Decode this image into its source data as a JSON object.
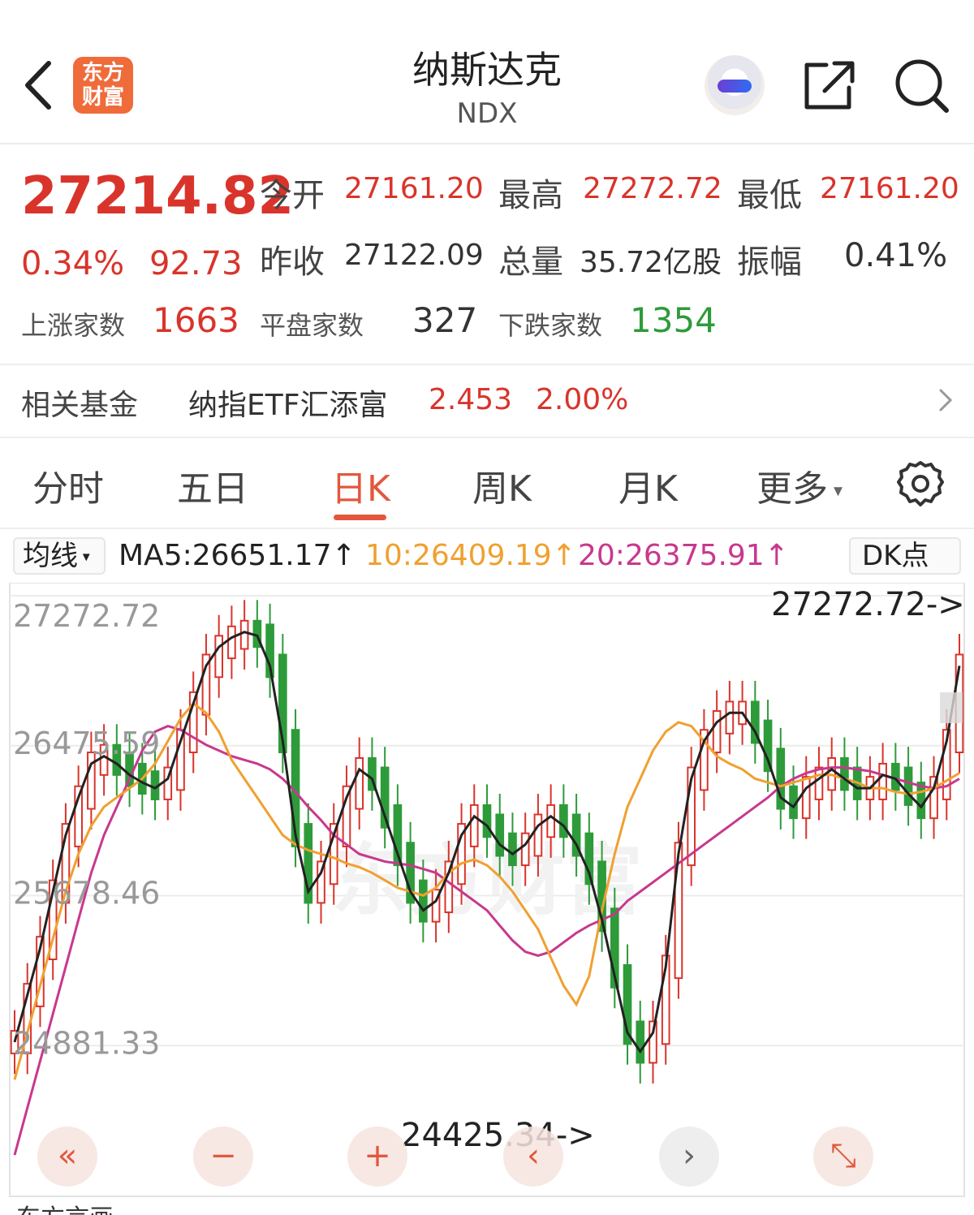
{
  "header": {
    "logo_line1": "东方",
    "logo_line2": "财富",
    "title": "纳斯达克",
    "subtitle": "NDX"
  },
  "quote": {
    "price": "27214.82",
    "change_pct": "0.34%",
    "change_amt": "92.73",
    "open_label": "今开",
    "open_value": "27161.20",
    "high_label": "最高",
    "high_value": "27272.72",
    "low_label": "最低",
    "low_value": "27161.20",
    "prev_close_label": "昨收",
    "prev_close_value": "27122.09",
    "volume_label": "总量",
    "volume_value": "35.72亿股",
    "amplitude_label": "振幅",
    "amplitude_value": "0.41%",
    "rise_label": "上涨家数",
    "rise_value": "1663",
    "flat_label": "平盘家数",
    "flat_value": "327",
    "fall_label": "下跌家数",
    "fall_value": "1354"
  },
  "fund": {
    "label": "相关基金",
    "name": "纳指ETF汇添富",
    "price": "2.453",
    "change": "2.00%"
  },
  "tabs": [
    "分时",
    "五日",
    "日K",
    "周K",
    "月K",
    "更多"
  ],
  "ma": {
    "selector": "均线",
    "ma5": "MA5:26651.17↑",
    "ma10": "10:26409.19↑",
    "ma20": "20:26375.91↑",
    "dk": "DK点"
  },
  "colors": {
    "up": "#d9342b",
    "down": "#2e9b3a",
    "accent": "#e2583e",
    "ma5": "#222222",
    "ma10": "#f0a030",
    "ma20": "#c8388e"
  },
  "icons": [
    "back-arrow-icon",
    "share-icon",
    "search-icon",
    "gear-icon",
    "dropdown-caret-icon",
    "chevron-right-icon"
  ],
  "chart_data": {
    "type": "candlestick",
    "y_tick_labels": [
      "27272.72",
      "26475.59",
      "25678.46",
      "24881.33"
    ],
    "ylim": [
      24425.34,
      27272.72
    ],
    "high_marker": "27272.72->",
    "low_marker": "24425.34->",
    "watermark": "东方财富",
    "ma5": [
      24900,
      25150,
      25400,
      25700,
      26000,
      26200,
      26380,
      26420,
      26380,
      26320,
      26280,
      26250,
      26300,
      26500,
      26700,
      26900,
      27000,
      27050,
      27080,
      27060,
      26900,
      26500,
      26000,
      25700,
      25800,
      26000,
      26200,
      26350,
      26300,
      26100,
      25900,
      25700,
      25600,
      25650,
      25800,
      26000,
      26100,
      26050,
      25950,
      25900,
      25950,
      26050,
      26100,
      26050,
      25950,
      25800,
      25550,
      25250,
      24950,
      24850,
      24950,
      25300,
      25900,
      26300,
      26500,
      26600,
      26650,
      26650,
      26550,
      26400,
      26200,
      26150,
      26250,
      26300,
      26350,
      26300,
      26250,
      26250,
      26320,
      26300,
      26220,
      26150,
      26250,
      26500,
      26900
    ],
    "ma10": [
      24700,
      24950,
      25200,
      25450,
      25700,
      25900,
      26050,
      26150,
      26200,
      26250,
      26300,
      26380,
      26500,
      26620,
      26700,
      26650,
      26550,
      26400,
      26300,
      26200,
      26100,
      26000,
      25950,
      25920,
      25900,
      25880,
      25850,
      25830,
      25800,
      25760,
      25720,
      25700,
      25680,
      25720,
      25800,
      25850,
      25870,
      25840,
      25780,
      25700,
      25600,
      25500,
      25350,
      25200,
      25100,
      25250,
      25600,
      25900,
      26150,
      26300,
      26450,
      26550,
      26600,
      26580,
      26500,
      26420,
      26380,
      26350,
      26300,
      26280,
      26260,
      26280,
      26300,
      26320,
      26320,
      26300,
      26280,
      26250,
      26250,
      26230,
      26220,
      26230,
      26250,
      26290,
      26330
    ],
    "ma20": [
      24300,
      24550,
      24800,
      25050,
      25300,
      25550,
      25800,
      26000,
      26150,
      26300,
      26450,
      26550,
      26580,
      26560,
      26520,
      26480,
      26450,
      26420,
      26400,
      26380,
      26350,
      26300,
      26230,
      26150,
      26080,
      26000,
      25950,
      25900,
      25880,
      25860,
      25850,
      25840,
      25820,
      25800,
      25750,
      25700,
      25650,
      25600,
      25520,
      25440,
      25380,
      25360,
      25380,
      25430,
      25480,
      25520,
      25550,
      25580,
      25650,
      25700,
      25750,
      25800,
      25850,
      25900,
      25950,
      26000,
      26050,
      26100,
      26150,
      26200,
      26260,
      26300,
      26330,
      26350,
      26360,
      26360,
      26350,
      26340,
      26320,
      26300,
      26280,
      26260,
      26250,
      26260,
      26300
    ]
  },
  "controls": [
    "«",
    "−",
    "+",
    "‹",
    "›",
    "⤡"
  ],
  "bottom_text": "东方言画"
}
